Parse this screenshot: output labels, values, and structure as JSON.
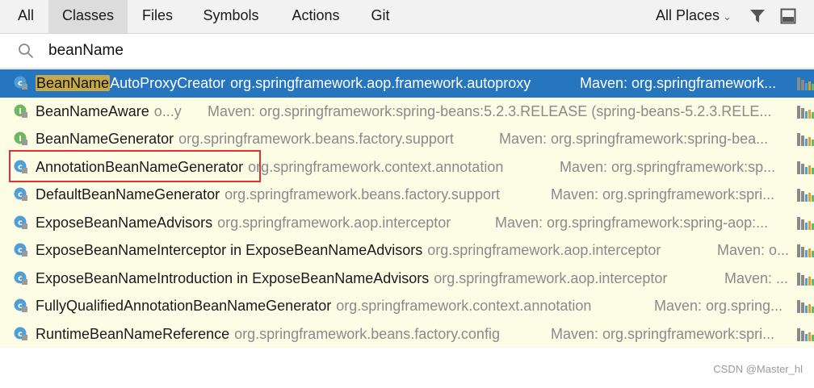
{
  "tabs": [
    "All",
    "Classes",
    "Files",
    "Symbols",
    "Actions",
    "Git"
  ],
  "active_tab": "Classes",
  "scope": "All Places",
  "search": {
    "value": "beanName"
  },
  "results": [
    {
      "icon": "class-icon",
      "highlight": "BeanName",
      "name": "AutoProxyCreator",
      "package": "org.springframework.aop.framework.autoproxy",
      "location": "Maven: org.springframework...",
      "selected": true
    },
    {
      "icon": "interface-icon",
      "highlight": "",
      "name": "BeanNameAware",
      "package": "o...y",
      "location": "Maven: org.springframework:spring-beans:5.2.3.RELEASE (spring-beans-5.2.3.RELE..."
    },
    {
      "icon": "interface-icon",
      "highlight": "",
      "name": "BeanNameGenerator",
      "package": "org.springframework.beans.factory.support",
      "location": "Maven: org.springframework:spring-bea..."
    },
    {
      "icon": "class-icon",
      "highlight": "",
      "name": "AnnotationBeanNameGenerator",
      "package": "org.springframework.context.annotation",
      "location": "Maven: org.springframework:sp..."
    },
    {
      "icon": "class-icon",
      "highlight": "",
      "name": "DefaultBeanNameGenerator",
      "package": "org.springframework.beans.factory.support",
      "location": "Maven: org.springframework:spri..."
    },
    {
      "icon": "class-icon",
      "highlight": "",
      "name": "ExposeBeanNameAdvisors",
      "package": "org.springframework.aop.interceptor",
      "location": "Maven: org.springframework:spring-aop:..."
    },
    {
      "icon": "class-icon",
      "highlight": "",
      "name": "ExposeBeanNameInterceptor in ExposeBeanNameAdvisors",
      "package": "org.springframework.aop.interceptor",
      "location": "Maven: o..."
    },
    {
      "icon": "class-icon",
      "highlight": "",
      "name": "ExposeBeanNameIntroduction in ExposeBeanNameAdvisors",
      "package": "org.springframework.aop.interceptor",
      "location": "Maven: ..."
    },
    {
      "icon": "class-icon",
      "highlight": "",
      "name": "FullyQualifiedAnnotationBeanNameGenerator",
      "package": "org.springframework.context.annotation",
      "location": "Maven: org.spring..."
    },
    {
      "icon": "class-icon",
      "highlight": "",
      "name": "RuntimeBeanNameReference",
      "package": "org.springframework.beans.factory.config",
      "location": "Maven: org.springframework:spri..."
    }
  ],
  "watermark": "CSDN @Master_hl"
}
